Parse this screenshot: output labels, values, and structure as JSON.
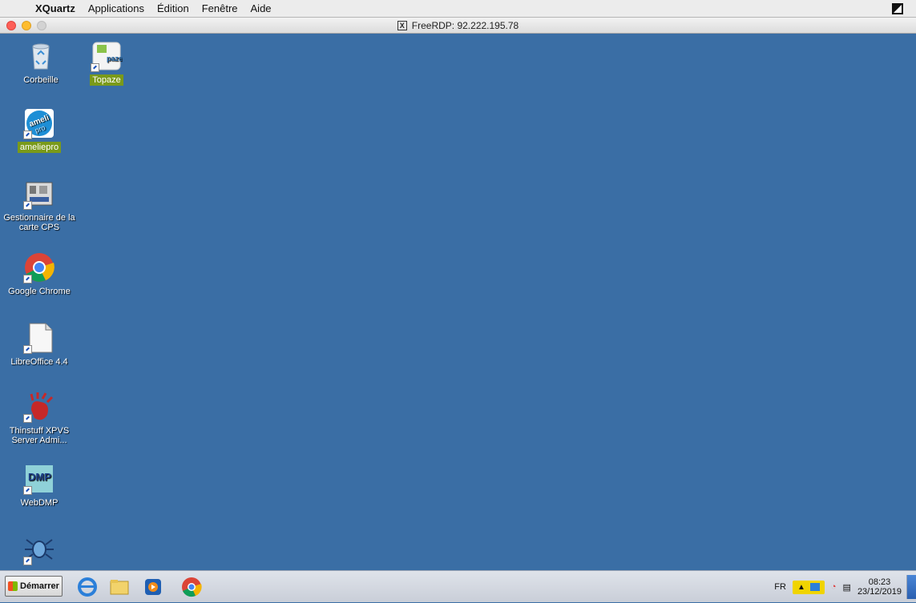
{
  "mac_menu": {
    "app_name": "XQuartz",
    "items": [
      "Applications",
      "Édition",
      "Fenêtre",
      "Aide"
    ]
  },
  "window": {
    "title": "FreeRDP: 92.222.195.78"
  },
  "desktop_icons": [
    {
      "label": "Corbeille",
      "icon": "recycle-bin-icon"
    },
    {
      "label": "Topaze",
      "icon": "topaze-icon",
      "highlighted": true
    },
    {
      "label": "ameliepro",
      "icon": "ameli-pro-icon",
      "highlighted": true
    },
    {
      "label": "Gestionnaire de la carte CPS",
      "icon": "cps-manager-icon"
    },
    {
      "label": "Google Chrome",
      "icon": "chrome-icon"
    },
    {
      "label": "LibreOffice 4.4",
      "icon": "libreoffice-icon"
    },
    {
      "label": "Thinstuff XPVS Server Admi...",
      "icon": "thinstuff-icon"
    },
    {
      "label": "WebDMP",
      "icon": "webdmp-icon"
    },
    {
      "label": "",
      "icon": "bug-icon"
    }
  ],
  "taskbar": {
    "start_label": "Démarrer",
    "pinned": [
      "internet-explorer-icon",
      "file-explorer-icon",
      "media-player-icon",
      "chrome-icon"
    ],
    "tray": {
      "language": "FR",
      "time": "08:23",
      "date": "23/12/2019"
    }
  },
  "colors": {
    "desktop": "#3a6ea5",
    "highlight_green": "#7a9a1a",
    "tray_highlight": "#f0d400"
  }
}
